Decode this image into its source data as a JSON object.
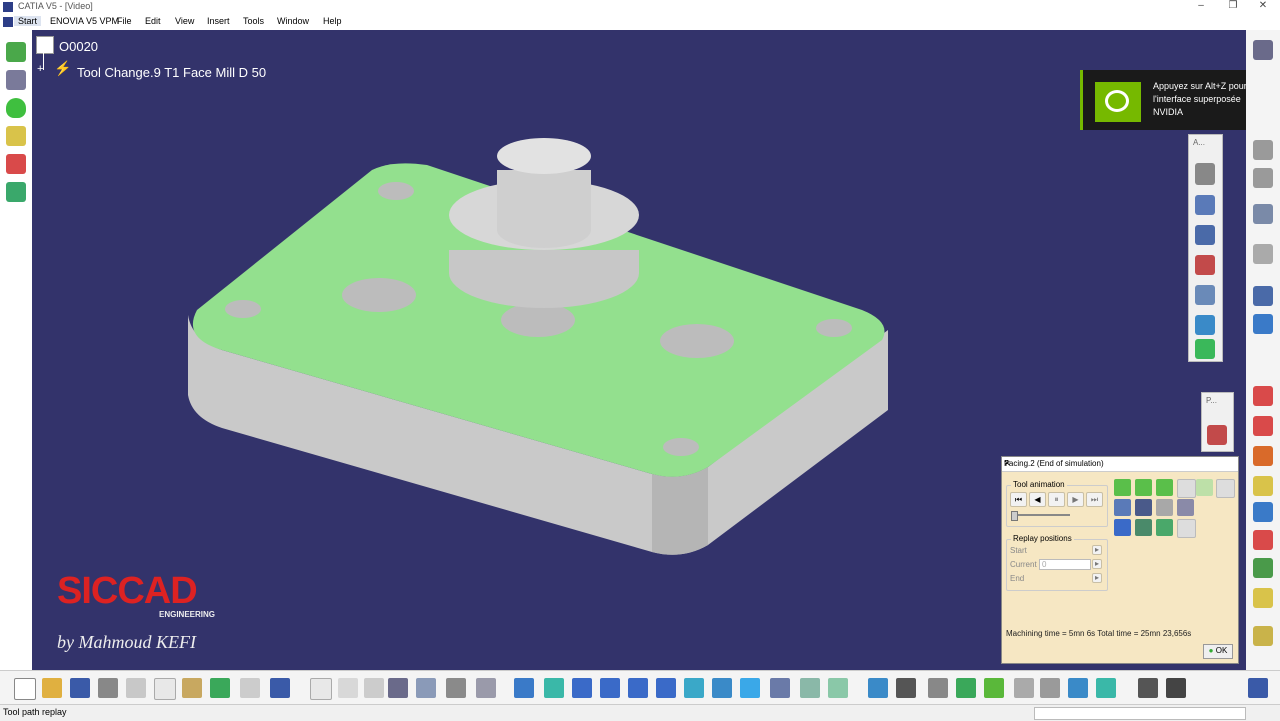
{
  "window": {
    "title": "CATIA V5 - [Video]"
  },
  "menu": {
    "items": [
      "Start",
      "ENOVIA V5 VPM",
      "File",
      "Edit",
      "View",
      "Insert",
      "Tools",
      "Window",
      "Help"
    ]
  },
  "tree": {
    "root": "O0020",
    "child": "Tool Change.9  T1 Face Mill D 50"
  },
  "overlay": {
    "nvidia_message": "Appuyez sur Alt+Z pour ouvrir l'interface superposée NVIDIA"
  },
  "floating_toolbars": {
    "a_label": "A...",
    "p_label": "P..."
  },
  "dialog": {
    "title": "Facing.2 (End of simulation)",
    "help": "?",
    "close": "✕",
    "tool_animation_label": "Tool animation",
    "replay_positions_label": "Replay positions",
    "start_label": "Start",
    "current_label": "Current",
    "current_value": "0",
    "end_label": "End",
    "machining_time": "Machining time = 5mn 6s   Total time = 25mn 23,656s",
    "ok_label": "OK"
  },
  "watermark": {
    "brand": "SICCAD",
    "sub": "ENGINEERING",
    "author": "by Mahmoud KEFI"
  },
  "status": {
    "text": "Tool path replay"
  },
  "colors": {
    "viewport_bg": "#33336b",
    "part_top": "#93e08e",
    "part_side": "#c9c9c9",
    "dialog_bg": "#f6e7c3",
    "nvidia_green": "#76b900"
  }
}
